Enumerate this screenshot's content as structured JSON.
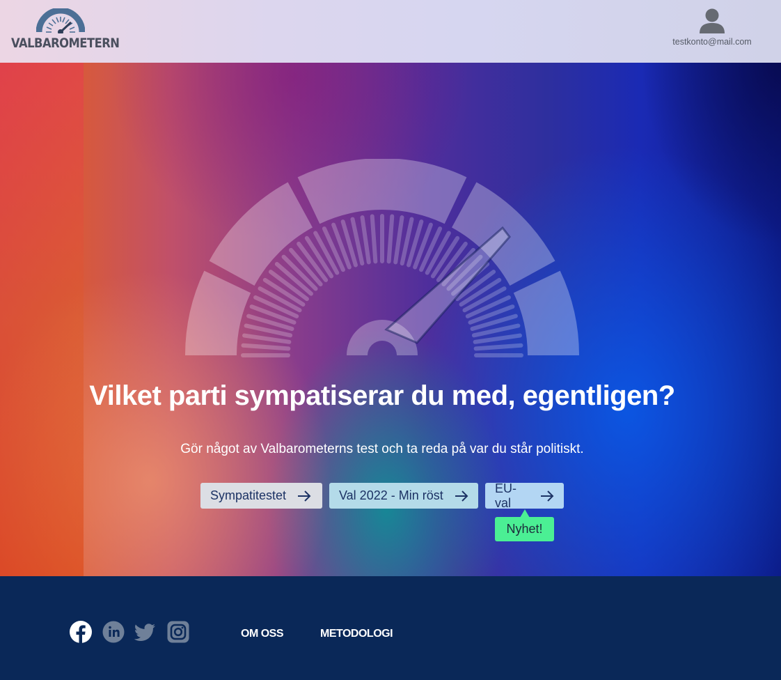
{
  "header": {
    "logo_text": "VALBAROMETERN",
    "user_email": "testkonto@mail.com"
  },
  "hero": {
    "title": "Vilket parti sympatiserar du med, egentligen?",
    "subtitle": "Gör något av Valbarometerns test och ta reda på var du står politiskt.",
    "buttons": [
      {
        "label": "Sympatitestet",
        "icon": "arrow-right-icon"
      },
      {
        "label": "Val 2022 - Min röst",
        "icon": "arrow-right-icon"
      },
      {
        "label": "EU-val",
        "icon": "arrow-right-icon"
      }
    ],
    "badge": "Nyhet!"
  },
  "footer": {
    "social": [
      "facebook-icon",
      "linkedin-icon",
      "twitter-icon",
      "instagram-icon"
    ],
    "links": [
      "OM OSS",
      "METODOLOGI"
    ]
  },
  "colors": {
    "footer_bg": "#0a2858",
    "button_text": "#1c3264",
    "badge_bg": "#4bef94",
    "logo_gray": "#4a4f5e"
  }
}
